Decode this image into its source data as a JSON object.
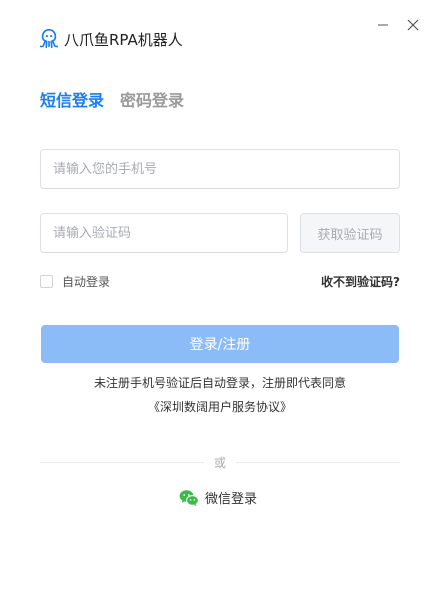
{
  "header": {
    "app_title": "八爪鱼RPA机器人",
    "logo_icon": "octopus-logo-icon"
  },
  "window_controls": {
    "minimize_icon": "minimize-icon",
    "close_icon": "close-icon"
  },
  "tabs": [
    {
      "label": "短信登录",
      "active": true
    },
    {
      "label": "密码登录",
      "active": false
    }
  ],
  "form": {
    "phone_placeholder": "请输入您的手机号",
    "phone_value": "",
    "code_placeholder": "请输入验证码",
    "code_value": "",
    "get_code_label": "获取验证码",
    "auto_login_label": "自动登录",
    "auto_login_checked": false,
    "no_code_label": "收不到验证码?",
    "submit_label": "登录/注册"
  },
  "footer": {
    "notice": "未注册手机号验证后自动登录，注册即代表同意",
    "agreement": "《深圳数阔用户服务协议》",
    "divider_text": "或",
    "wechat_label": "微信登录",
    "wechat_icon": "wechat-icon"
  },
  "colors": {
    "accent": "#1b7ef0",
    "submit_disabled": "#8cbcf8",
    "wechat_green": "#3fba4a"
  }
}
